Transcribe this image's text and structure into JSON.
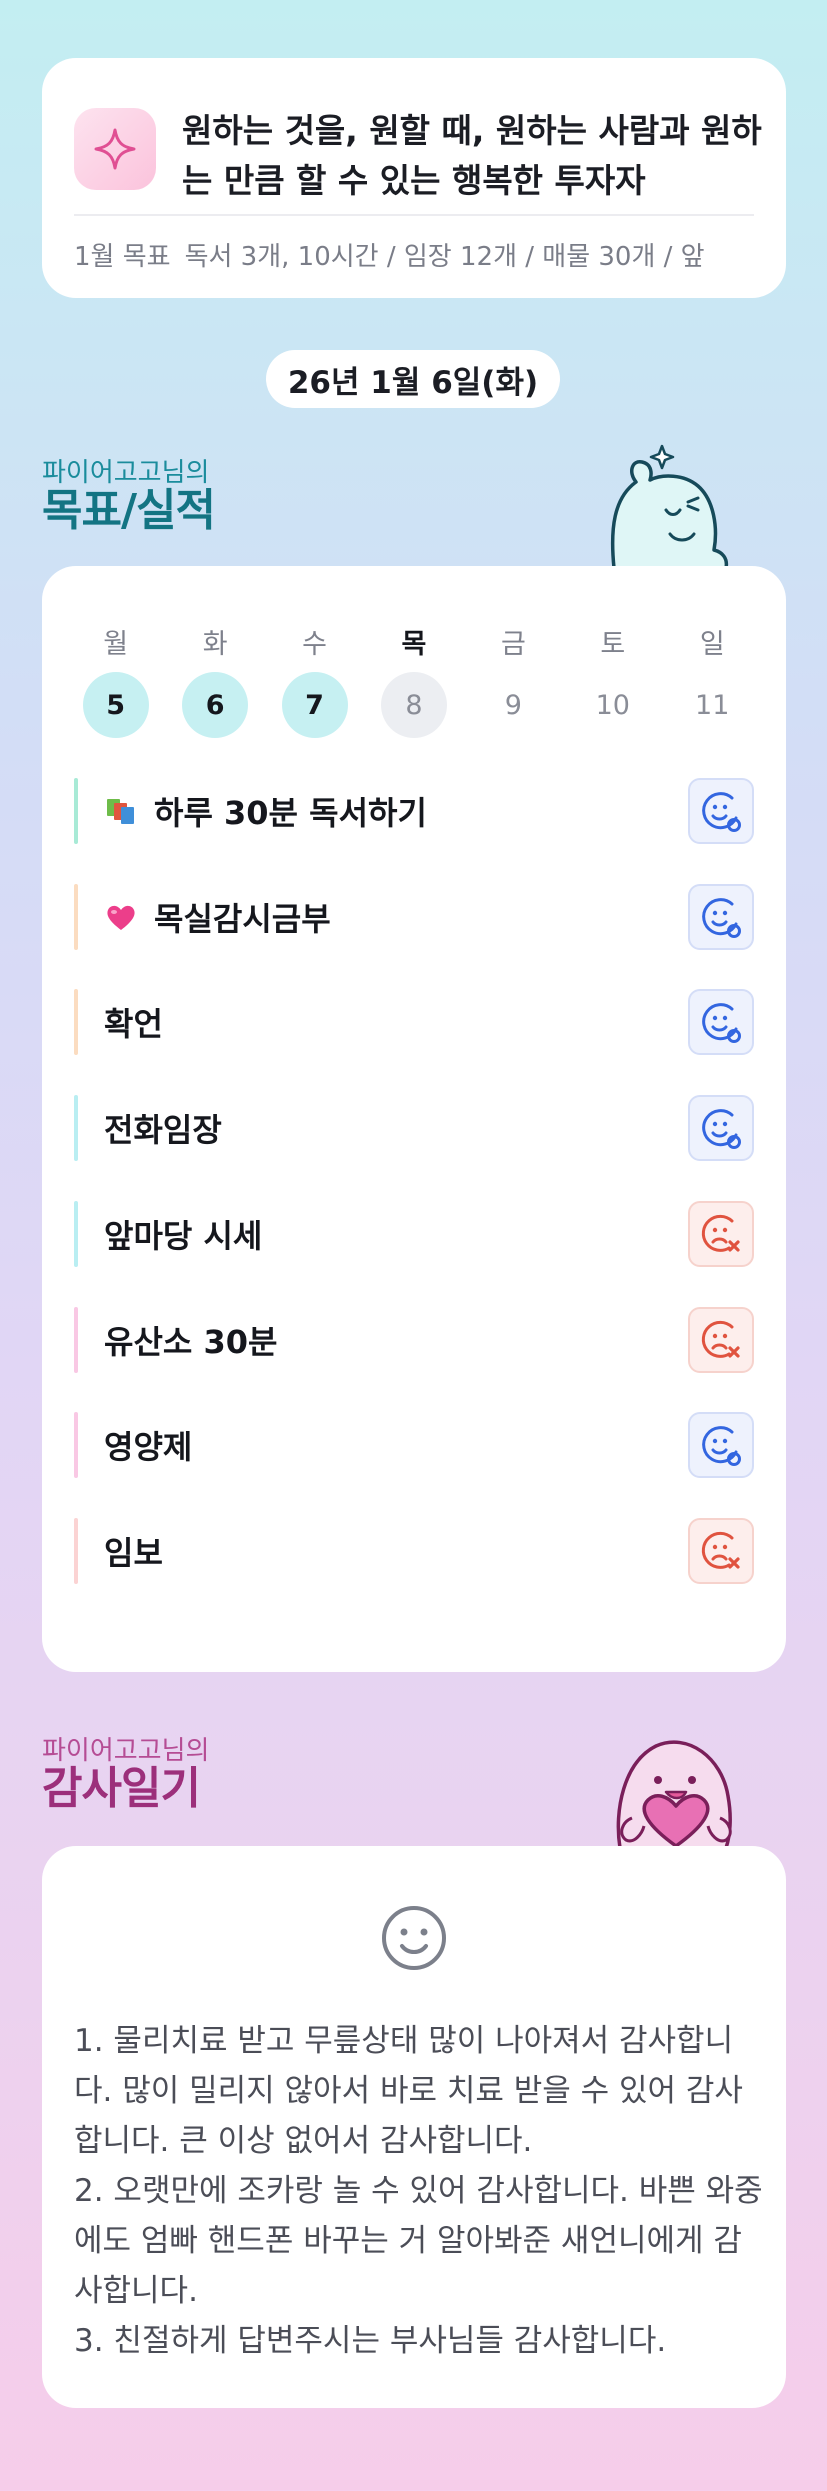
{
  "goal_card": {
    "title": "원하는 것을, 원할 때, 원하는 사람과 원하는 만큼 할 수 있는 행복한 투자자",
    "monthly_label": "1월 목표",
    "monthly_text": "독서 3개, 10시간 / 임장 12개 / 매물 30개 / 앞"
  },
  "date": "26년 1월 6일(화)",
  "goals_section": {
    "subtitle": "파이어고고님의",
    "title": "목표/실적"
  },
  "week": {
    "days": [
      {
        "label": "월",
        "num": "5",
        "state": "done"
      },
      {
        "label": "화",
        "num": "6",
        "state": "done"
      },
      {
        "label": "수",
        "num": "7",
        "state": "done"
      },
      {
        "label": "목",
        "num": "8",
        "state": "today"
      },
      {
        "label": "금",
        "num": "9",
        "state": "future"
      },
      {
        "label": "토",
        "num": "10",
        "state": "future"
      },
      {
        "label": "일",
        "num": "11",
        "state": "future"
      }
    ]
  },
  "tasks": [
    {
      "label": "하루 30분 독서하기",
      "emoji": "books-icon",
      "bar_color": "#a8ead6",
      "status": "ok"
    },
    {
      "label": "목실감시금부",
      "emoji": "heart-icon",
      "bar_color": "#fbdcc0",
      "status": "ok"
    },
    {
      "label": "확언",
      "emoji": "",
      "bar_color": "#fbdcc0",
      "status": "ok"
    },
    {
      "label": "전화임장",
      "emoji": "",
      "bar_color": "#b9eef2",
      "status": "ok"
    },
    {
      "label": "앞마당 시세",
      "emoji": "",
      "bar_color": "#b9eef2",
      "status": "fail"
    },
    {
      "label": "유산소 30분",
      "emoji": "",
      "bar_color": "#f9c8e4",
      "status": "fail"
    },
    {
      "label": "영양제",
      "emoji": "",
      "bar_color": "#f9c8e4",
      "status": "ok"
    },
    {
      "label": "임보",
      "emoji": "",
      "bar_color": "#fbd3d3",
      "status": "fail"
    }
  ],
  "diary_section": {
    "subtitle": "파이어고고님의",
    "title": "감사일기"
  },
  "diary": {
    "text": "1. 물리치료 받고 무릎상태 많이 나아져서 감사합니다. 많이 밀리지 않아서 바로 치료 받을 수 있어 감사합니다. 큰 이상 없어서 감사합니다.\n2. 오랫만에 조카랑 놀 수 있어 감사합니다. 바쁜 와중에도 엄빠 핸드폰 바꾸는 거 알아봐준 새언니에게 감사합니다.\n3. 친절하게 답변주시는 부사님들 감사합니다."
  },
  "colors": {
    "ok_icon": "#3366e0",
    "fail_icon": "#e0533f",
    "goals_heading": "#137483",
    "diary_heading": "#9c2f7b"
  }
}
